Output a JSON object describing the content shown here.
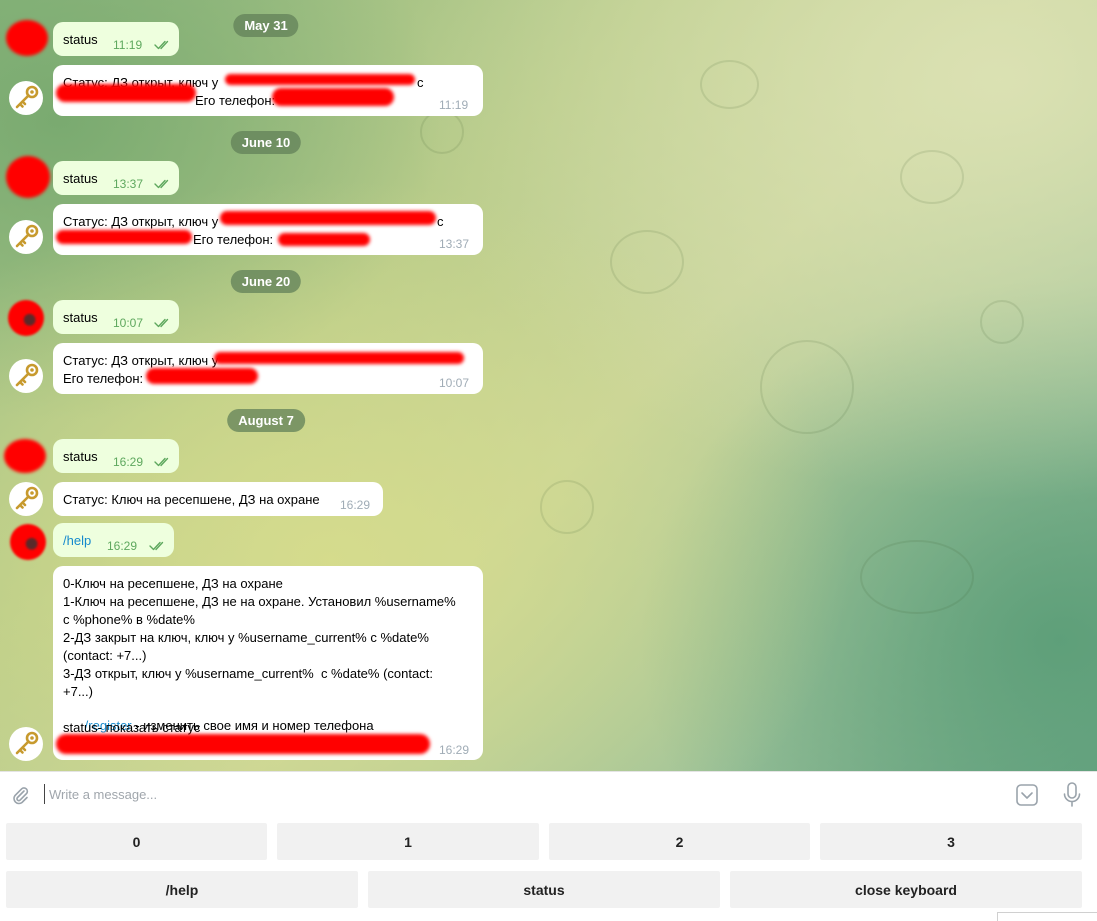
{
  "dates": [
    "May 31",
    "June 10",
    "June 20",
    "August 7"
  ],
  "messages": [
    {
      "text": "status",
      "time": "11:19"
    },
    {
      "line1": "Статус: ДЗ открыт, ключ у",
      "line1_end": "с",
      "line2": "Его телефон:",
      "time": "11:19"
    },
    {
      "text": "status",
      "time": "13:37"
    },
    {
      "line1": "Статус: ДЗ открыт, ключ у",
      "line1_end": "с",
      "line2": "Его телефон:",
      "time": "13:37"
    },
    {
      "text": "status",
      "time": "10:07"
    },
    {
      "line1": "Статус: ДЗ открыт, ключ у",
      "line2": "Его телефон:",
      "time": "10:07"
    },
    {
      "text": "status",
      "time": "16:29"
    },
    {
      "text": "Статус: Ключ на ресепшене, ДЗ на охране",
      "time": "16:29"
    },
    {
      "text": "/help",
      "time": "16:29"
    },
    {
      "lines": [
        "0-Ключ на ресепшене, ДЗ на охране",
        "1-Ключ на ресепшене, ДЗ не на охране. Установил %username%",
        "с %phone% в %date%",
        "2-ДЗ закрыт на ключ, ключ у %username_current% с %date%",
        "(contact: +7...)",
        "3-ДЗ открыт, ключ у %username_current%  с %date% (contact:",
        "+7...)"
      ],
      "register_link": "/register",
      "register_text": " - изменить свое имя и номер телефона",
      "status_line": "status- показать статус",
      "time": "16:29"
    }
  ],
  "composer": {
    "placeholder": "Write a message..."
  },
  "keyboard": {
    "row1": [
      "0",
      "1",
      "2",
      "3"
    ],
    "row2": [
      "/help",
      "status",
      "close keyboard"
    ]
  },
  "icons": [
    "paperclip-icon",
    "keyboard-toggle-icon",
    "microphone-icon",
    "key-avatar-icon",
    "double-check-icon"
  ],
  "colors": {
    "outgoing_bubble": "#eeffde",
    "incoming_bubble": "#ffffff",
    "link": "#168acd",
    "date_pill": "#6d8a62"
  }
}
